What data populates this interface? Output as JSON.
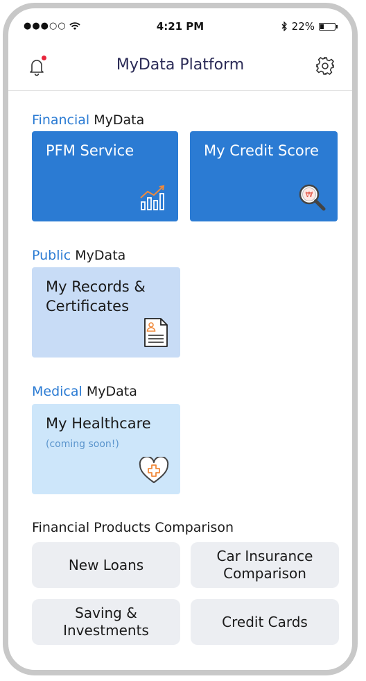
{
  "status_bar": {
    "signal": "●●●○○",
    "time": "4:21 PM",
    "battery": "22%",
    "battery_level": 0.22
  },
  "header": {
    "title": "MyData Platform"
  },
  "sections": {
    "financial": {
      "highlight": "Financial",
      "rest": "MyData"
    },
    "public": {
      "highlight": "Public",
      "rest": "MyData"
    },
    "medical": {
      "highlight": "Medical",
      "rest": "MyData"
    }
  },
  "tiles": {
    "pfm": {
      "label": "PFM Service",
      "icon": "chart-icon"
    },
    "credit": {
      "label": "My Credit Score",
      "icon": "magnifier-won-icon",
      "glyph": "₩"
    },
    "records": {
      "label": "My Records &\nCertificates",
      "icon": "document-icon"
    },
    "health": {
      "label": "My Healthcare",
      "sub": "(coming soon!)",
      "icon": "heart-cross-icon"
    }
  },
  "comparison": {
    "title": "Financial Products Comparison",
    "items": [
      {
        "label": "New Loans"
      },
      {
        "label": "Car Insurance\nComparison"
      },
      {
        "label": "Saving &\nInvestments"
      },
      {
        "label": "Credit Cards"
      }
    ]
  },
  "colors": {
    "accent": "#2b7bd3",
    "tile_blue": "#2b7bd3",
    "tile_light": "#c8dcf6",
    "tile_lighter": "#cde6fa",
    "notification": "#e8253b"
  }
}
